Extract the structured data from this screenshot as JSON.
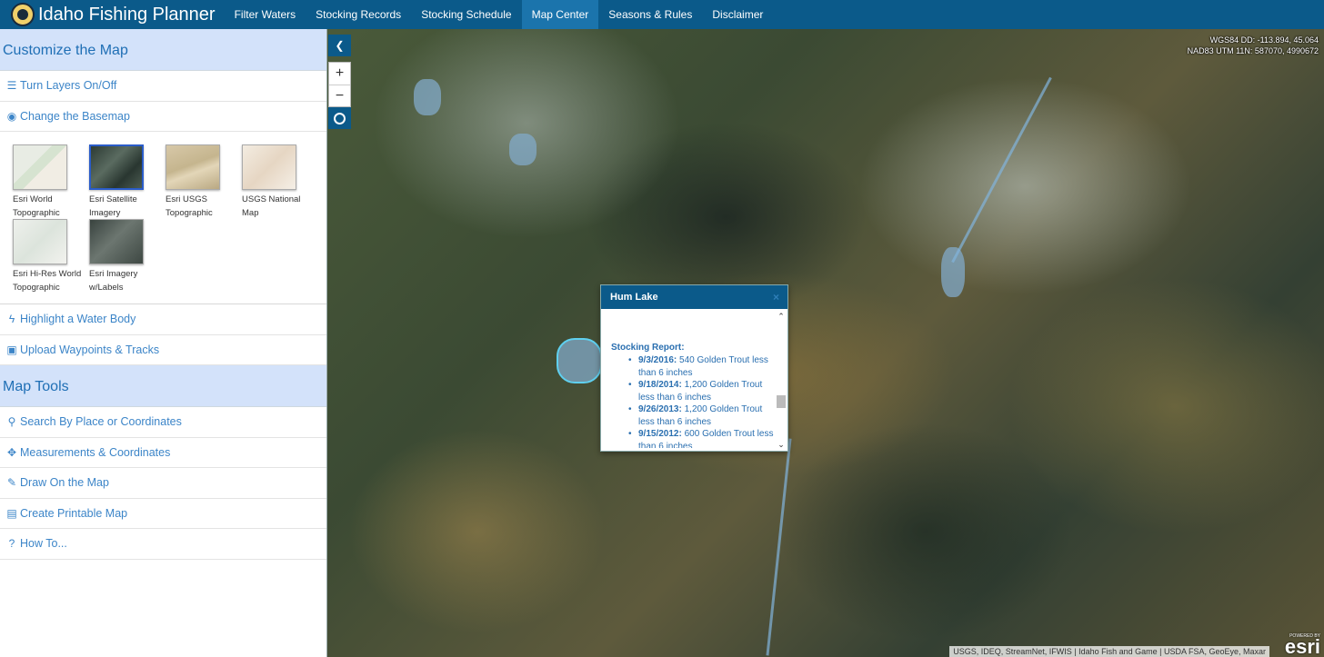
{
  "app": {
    "title": "Idaho Fishing Planner"
  },
  "nav": [
    {
      "label": "Filter Waters",
      "active": false
    },
    {
      "label": "Stocking Records",
      "active": false
    },
    {
      "label": "Stocking Schedule",
      "active": false
    },
    {
      "label": "Map Center",
      "active": true
    },
    {
      "label": "Seasons & Rules",
      "active": false
    },
    {
      "label": "Disclaimer",
      "active": false
    }
  ],
  "sidebar": {
    "customize_title": "Customize the Map",
    "layers": {
      "label": "Turn Layers On/Off",
      "icon": "list-icon"
    },
    "basemap": {
      "label": "Change the Basemap",
      "icon": "globe-icon"
    },
    "basemaps": [
      {
        "label": "Esri World Topographic",
        "selected": false
      },
      {
        "label": "Esri Satellite Imagery",
        "selected": true
      },
      {
        "label": "Esri USGS Topographic",
        "selected": false
      },
      {
        "label": "USGS National Map",
        "selected": false
      },
      {
        "label": "Esri Hi-Res World Topographic",
        "selected": false
      },
      {
        "label": "Esri Imagery w/Labels",
        "selected": false
      }
    ],
    "highlight": {
      "label": "Highlight a Water Body",
      "icon": "bolt-icon"
    },
    "upload": {
      "label": "Upload Waypoints & Tracks",
      "icon": "upload-icon"
    },
    "tools_title": "Map Tools",
    "search": {
      "label": "Search By Place or Coordinates",
      "icon": "search-icon"
    },
    "measure": {
      "label": "Measurements & Coordinates",
      "icon": "crosshair-icon"
    },
    "draw": {
      "label": "Draw On the Map",
      "icon": "pencil-icon"
    },
    "print": {
      "label": "Create Printable Map",
      "icon": "print-icon"
    },
    "howto": {
      "label": "How To...",
      "icon": "question-icon"
    }
  },
  "map": {
    "coords_wgs": "WGS84 DD: -113.894, 45.064",
    "coords_nad": "NAD83 UTM 11N: 587070, 4990672",
    "attribution": "USGS, IDEQ, StreamNet, IFWIS | Idaho Fish and Game | USDA FSA, GeoEye, Maxar",
    "esri_powered": "POWERED BY",
    "esri_logo": "esri"
  },
  "popup": {
    "title": "Hum Lake",
    "close": "×",
    "subtitle": "Stocking Report:",
    "records": [
      {
        "date": "9/3/2016:",
        "text": "540 Golden Trout less than 6 inches"
      },
      {
        "date": "9/18/2014:",
        "text": "1,200 Golden Trout less than 6 inches"
      },
      {
        "date": "9/26/2013:",
        "text": "1,200 Golden Trout less than 6 inches"
      },
      {
        "date": "9/15/2012:",
        "text": "600 Golden Trout less than 6 inches"
      }
    ]
  }
}
